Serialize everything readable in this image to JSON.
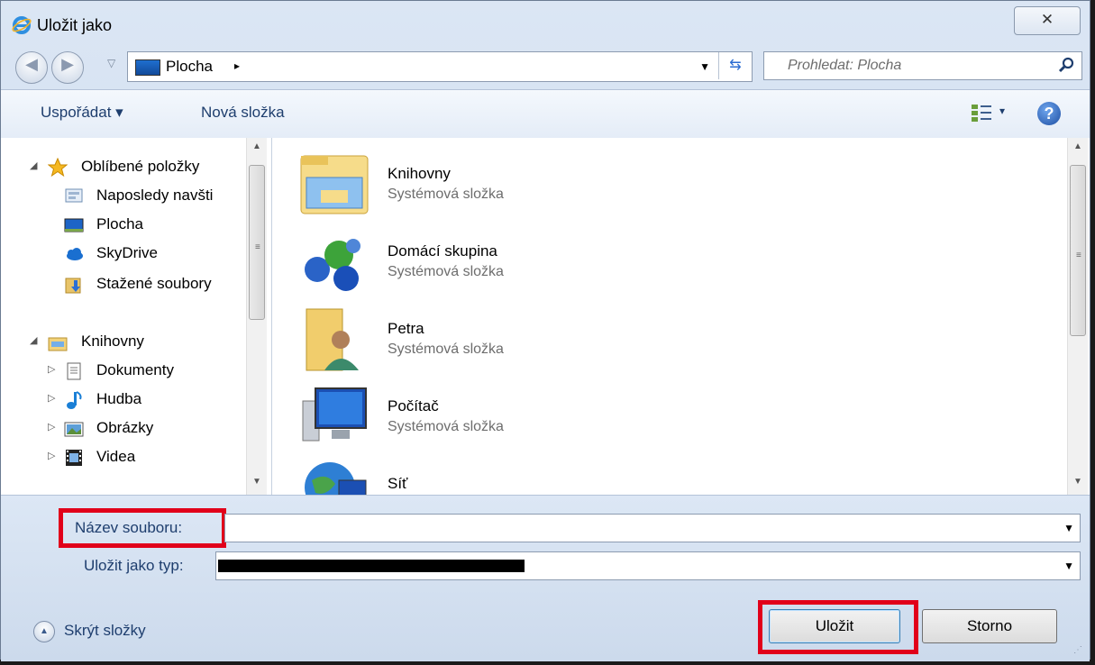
{
  "window": {
    "title": "Uložit jako",
    "close_label": "✕"
  },
  "address_bar": {
    "path": "Plocha",
    "separator": "▸"
  },
  "search": {
    "placeholder": "Prohledat: Plocha"
  },
  "toolbar": {
    "organize_label": "Uspořádat ▾",
    "new_folder_label": "Nová složka",
    "view_dropdown": "▾",
    "help_label": "?"
  },
  "nav_tree": {
    "favorites": {
      "label": "Oblíbené položky",
      "items": [
        {
          "label": "Naposledy navšti",
          "icon": "recent-places-icon"
        },
        {
          "label": "Plocha",
          "icon": "desktop-icon"
        },
        {
          "label": "SkyDrive",
          "icon": "skydrive-icon"
        },
        {
          "label": "Stažené soubory",
          "icon": "downloads-icon"
        }
      ]
    },
    "libraries": {
      "label": "Knihovny",
      "items": [
        {
          "label": "Dokumenty",
          "icon": "documents-icon"
        },
        {
          "label": "Hudba",
          "icon": "music-icon"
        },
        {
          "label": "Obrázky",
          "icon": "pictures-icon"
        },
        {
          "label": "Videa",
          "icon": "videos-icon"
        }
      ]
    }
  },
  "content": {
    "items": [
      {
        "name": "Knihovny",
        "type": "Systémová složka",
        "icon": "libraries-folder-icon"
      },
      {
        "name": "Domácí skupina",
        "type": "Systémová složka",
        "icon": "homegroup-icon"
      },
      {
        "name": "Petra",
        "type": "Systémová složka",
        "icon": "user-folder-icon"
      },
      {
        "name": "Počítač",
        "type": "Systémová složka",
        "icon": "computer-icon"
      },
      {
        "name": "Síť",
        "type": "",
        "icon": "network-icon"
      }
    ]
  },
  "form": {
    "filename_label": "Název souboru:",
    "filename_value": "",
    "filetype_label": "Uložit jako typ:",
    "filetype_value": ""
  },
  "footer": {
    "hide_folders_label": "Skrýt složky",
    "save_label": "Uložit",
    "cancel_label": "Storno"
  },
  "colors": {
    "highlight": "#e1001a",
    "label_blue": "#1e3e6e"
  }
}
